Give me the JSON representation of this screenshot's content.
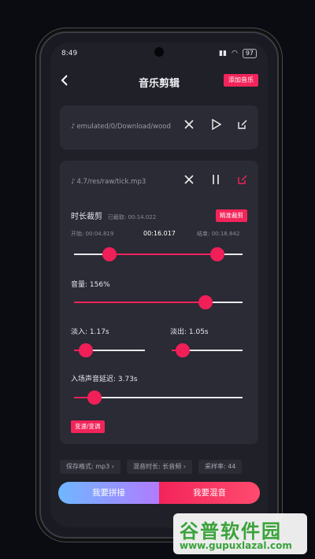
{
  "status": {
    "time": "8:49",
    "battery": "97"
  },
  "header": {
    "title": "音乐剪辑",
    "add_label": "添加音乐"
  },
  "card1": {
    "path": "emulated/0/Download/wood"
  },
  "card2": {
    "path": "4.7/res/raw/tick.mp3",
    "trim": {
      "title": "时长裁剪",
      "captured": "已截取: 00:14.022",
      "precise_label": "精准裁剪",
      "start": "开始: 00:04.819",
      "current": "00:16.017",
      "end": "结束: 00:18.842",
      "start_fraction": 0.21,
      "end_fraction": 0.85
    },
    "volume": {
      "label": "音量: 156%",
      "fraction": 0.78
    },
    "fadein": {
      "label": "淡入: 1.17s",
      "fraction": 0.17
    },
    "fadeout": {
      "label": "淡出: 1.05s",
      "fraction": 0.15
    },
    "delay": {
      "label": "入场声音延迟: 3.73s",
      "fraction": 0.12
    },
    "speed_label": "变速/变调"
  },
  "chips": [
    "保存格式: mp3",
    "混音时长: 长音频",
    "采样率: 44"
  ],
  "buttons": {
    "concat": "我要拼接",
    "mix": "我要混音"
  },
  "watermark": {
    "brand": "谷普软件园",
    "url": "www.gupuxlazal.com"
  },
  "colors": {
    "accent": "#f2245a",
    "blue": "#6fb7ff"
  }
}
